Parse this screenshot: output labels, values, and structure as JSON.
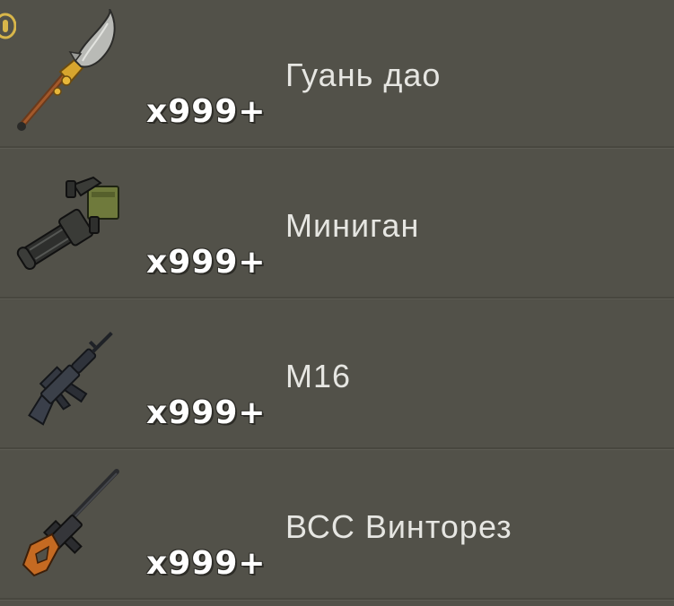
{
  "items": [
    {
      "name": "Гуань дао",
      "count": "x999+",
      "icon": "guan-dao-glaive-icon"
    },
    {
      "name": "Миниган",
      "count": "x999+",
      "icon": "minigun-icon"
    },
    {
      "name": "M16",
      "count": "x999+",
      "icon": "m16-rifle-icon"
    },
    {
      "name": "ВСС Винторез",
      "count": "x999+",
      "icon": "vss-vintorez-rifle-icon"
    }
  ],
  "colors": {
    "background": "#525149",
    "divider": "#48473f",
    "name_text": "#e6e6e2",
    "count_text": "#ffffff",
    "badge": "#d8b64a"
  }
}
